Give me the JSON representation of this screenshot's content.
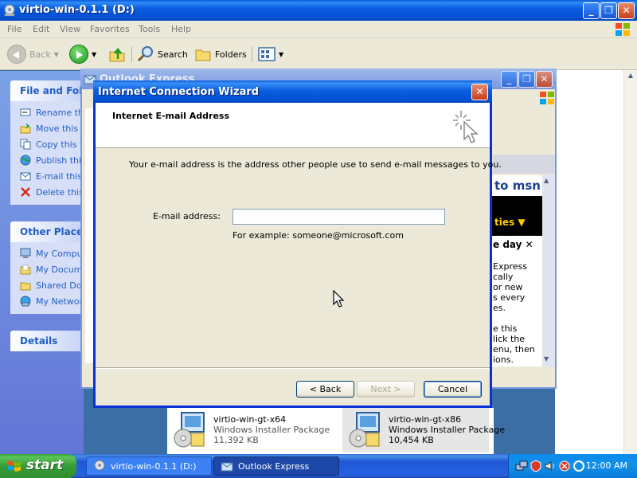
{
  "explorer": {
    "title": "virtio-win-0.1.1 (D:)",
    "menu": [
      "File",
      "Edit",
      "View",
      "Favorites",
      "Tools",
      "Help"
    ],
    "toolbar": {
      "back": "Back",
      "search": "Search",
      "folders": "Folders"
    },
    "file_folder_tasks": {
      "title": "File and Folder Tasks",
      "items": [
        "Rename this file",
        "Move this file",
        "Copy this file",
        "Publish this file to the Web",
        "E-mail this file",
        "Delete this file"
      ]
    },
    "other_places": {
      "title": "Other Places",
      "items": [
        "My Computer",
        "My Documents",
        "Shared Documents",
        "My Network Places"
      ]
    },
    "details": {
      "title": "Details"
    },
    "files": [
      {
        "name": "virtio-win-gt-x64",
        "type": "Windows Installer Package",
        "size": "11,392 KB"
      },
      {
        "name": "virtio-win-gt-x86",
        "type": "Windows Installer Package",
        "size": "10,454 KB"
      }
    ]
  },
  "outlook": {
    "title": "Outlook Express",
    "msn": "to msn",
    "band": "ties",
    "today": "e day",
    "text": "Express\ncally\nor new\ns every\nes.\n\ne this\nlick the\nenu, then\nions."
  },
  "wizard": {
    "title": "Internet Connection Wizard",
    "close": "X",
    "heading": "Internet E-mail Address",
    "description": "Your e-mail address is the address other people use to send e-mail messages to you.",
    "email_label": "E-mail address:",
    "email_value": "",
    "example": "For example: someone@microsoft.com",
    "back_label": "< Back",
    "next_label": "Next >",
    "cancel_label": "Cancel"
  },
  "taskbar": {
    "start": "start",
    "tasks": [
      "virtio-win-0.1.1 (D:)",
      "Outlook Express"
    ],
    "clock": "12:00 AM"
  },
  "colors": {
    "xp_blue": "#0350d4",
    "task_blue": "#215dc6",
    "start_green": "#349e34"
  }
}
